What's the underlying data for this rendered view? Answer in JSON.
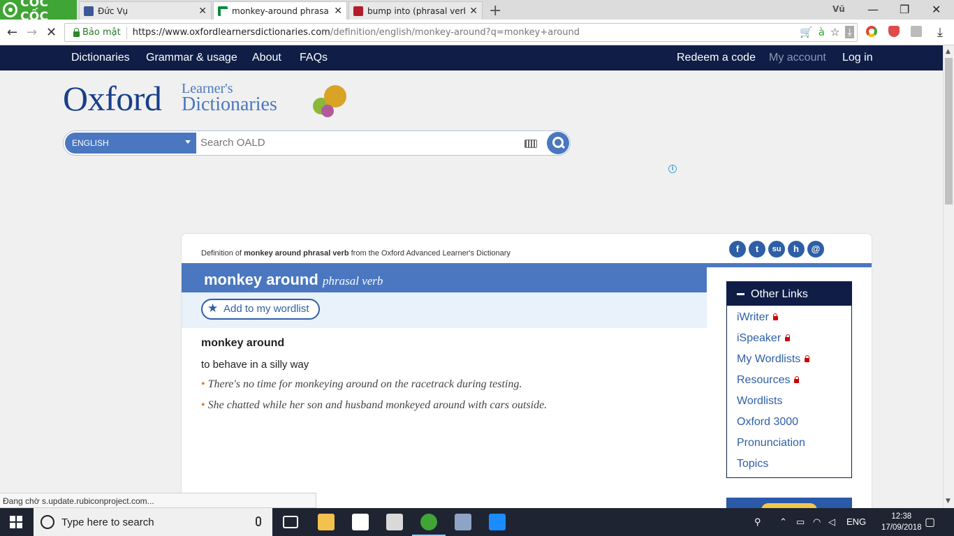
{
  "browser": {
    "brand": "CỐC CỐC",
    "user": "Vũ",
    "tabs": [
      {
        "title": "Đức Vụ",
        "close": "✕"
      },
      {
        "title": "monkey-around phrasal ve",
        "close": "✕"
      },
      {
        "title": "bump into (phrasal verb) d",
        "close": "✕"
      }
    ],
    "new_tab": "+",
    "window_controls": {
      "minimize": "—",
      "restore": "❐",
      "close": "✕"
    },
    "nav": {
      "back": "←",
      "forward": "→",
      "stop": "✕"
    },
    "security_label": "Bảo mật",
    "url_host": "https://www.oxfordlearnersdictionaries.com",
    "url_path": "/definition/english/monkey-around?q=monkey+around",
    "download": "⤓"
  },
  "site_nav": {
    "left": [
      "Dictionaries",
      "Grammar & usage",
      "About",
      "FAQs"
    ],
    "right": [
      "Redeem a code",
      "My account",
      "Log in"
    ]
  },
  "logo": {
    "main": "Oxford",
    "line1": "Learner's",
    "line2": "Dictionaries"
  },
  "search": {
    "language": "ENGLISH",
    "placeholder": "Search OALD"
  },
  "entry": {
    "source_prefix": "Definition of ",
    "source_bold": "monkey around phrasal verb",
    "source_suffix": " from the Oxford Advanced Learner's Dictionary",
    "headword": "monkey around",
    "pos": "phrasal verb",
    "wordlist_button": "Add to my wordlist",
    "sense_headword": "monkey around",
    "definition": "to behave in a silly way",
    "examples": [
      "There's no time for monkeying around on the racetrack during testing.",
      "She chatted while her son and husband monkeyed around with cars outside."
    ],
    "social": [
      "f",
      "t",
      "su",
      "h",
      "@"
    ]
  },
  "other_links": {
    "title": "Other Links",
    "items": [
      {
        "label": "iWriter",
        "locked": true
      },
      {
        "label": "iSpeaker",
        "locked": true
      },
      {
        "label": "My Wordlists",
        "locked": true
      },
      {
        "label": "Resources",
        "locked": true
      },
      {
        "label": "Wordlists",
        "locked": false
      },
      {
        "label": "Oxford 3000",
        "locked": false
      },
      {
        "label": "Pronunciation",
        "locked": false
      },
      {
        "label": "Topics",
        "locked": false
      }
    ]
  },
  "status_bar": "Đang chờ s.update.rubiconproject.com...",
  "taskbar": {
    "search_placeholder": "Type here to search",
    "lang": "ENG",
    "time": "12:38",
    "date": "17/09/2018"
  },
  "colors": {
    "nav": "#0f1d47",
    "accent": "#4a77c0",
    "link": "#2e5fa6",
    "brand": "#3fa535",
    "bullet": "#e07a1f"
  }
}
